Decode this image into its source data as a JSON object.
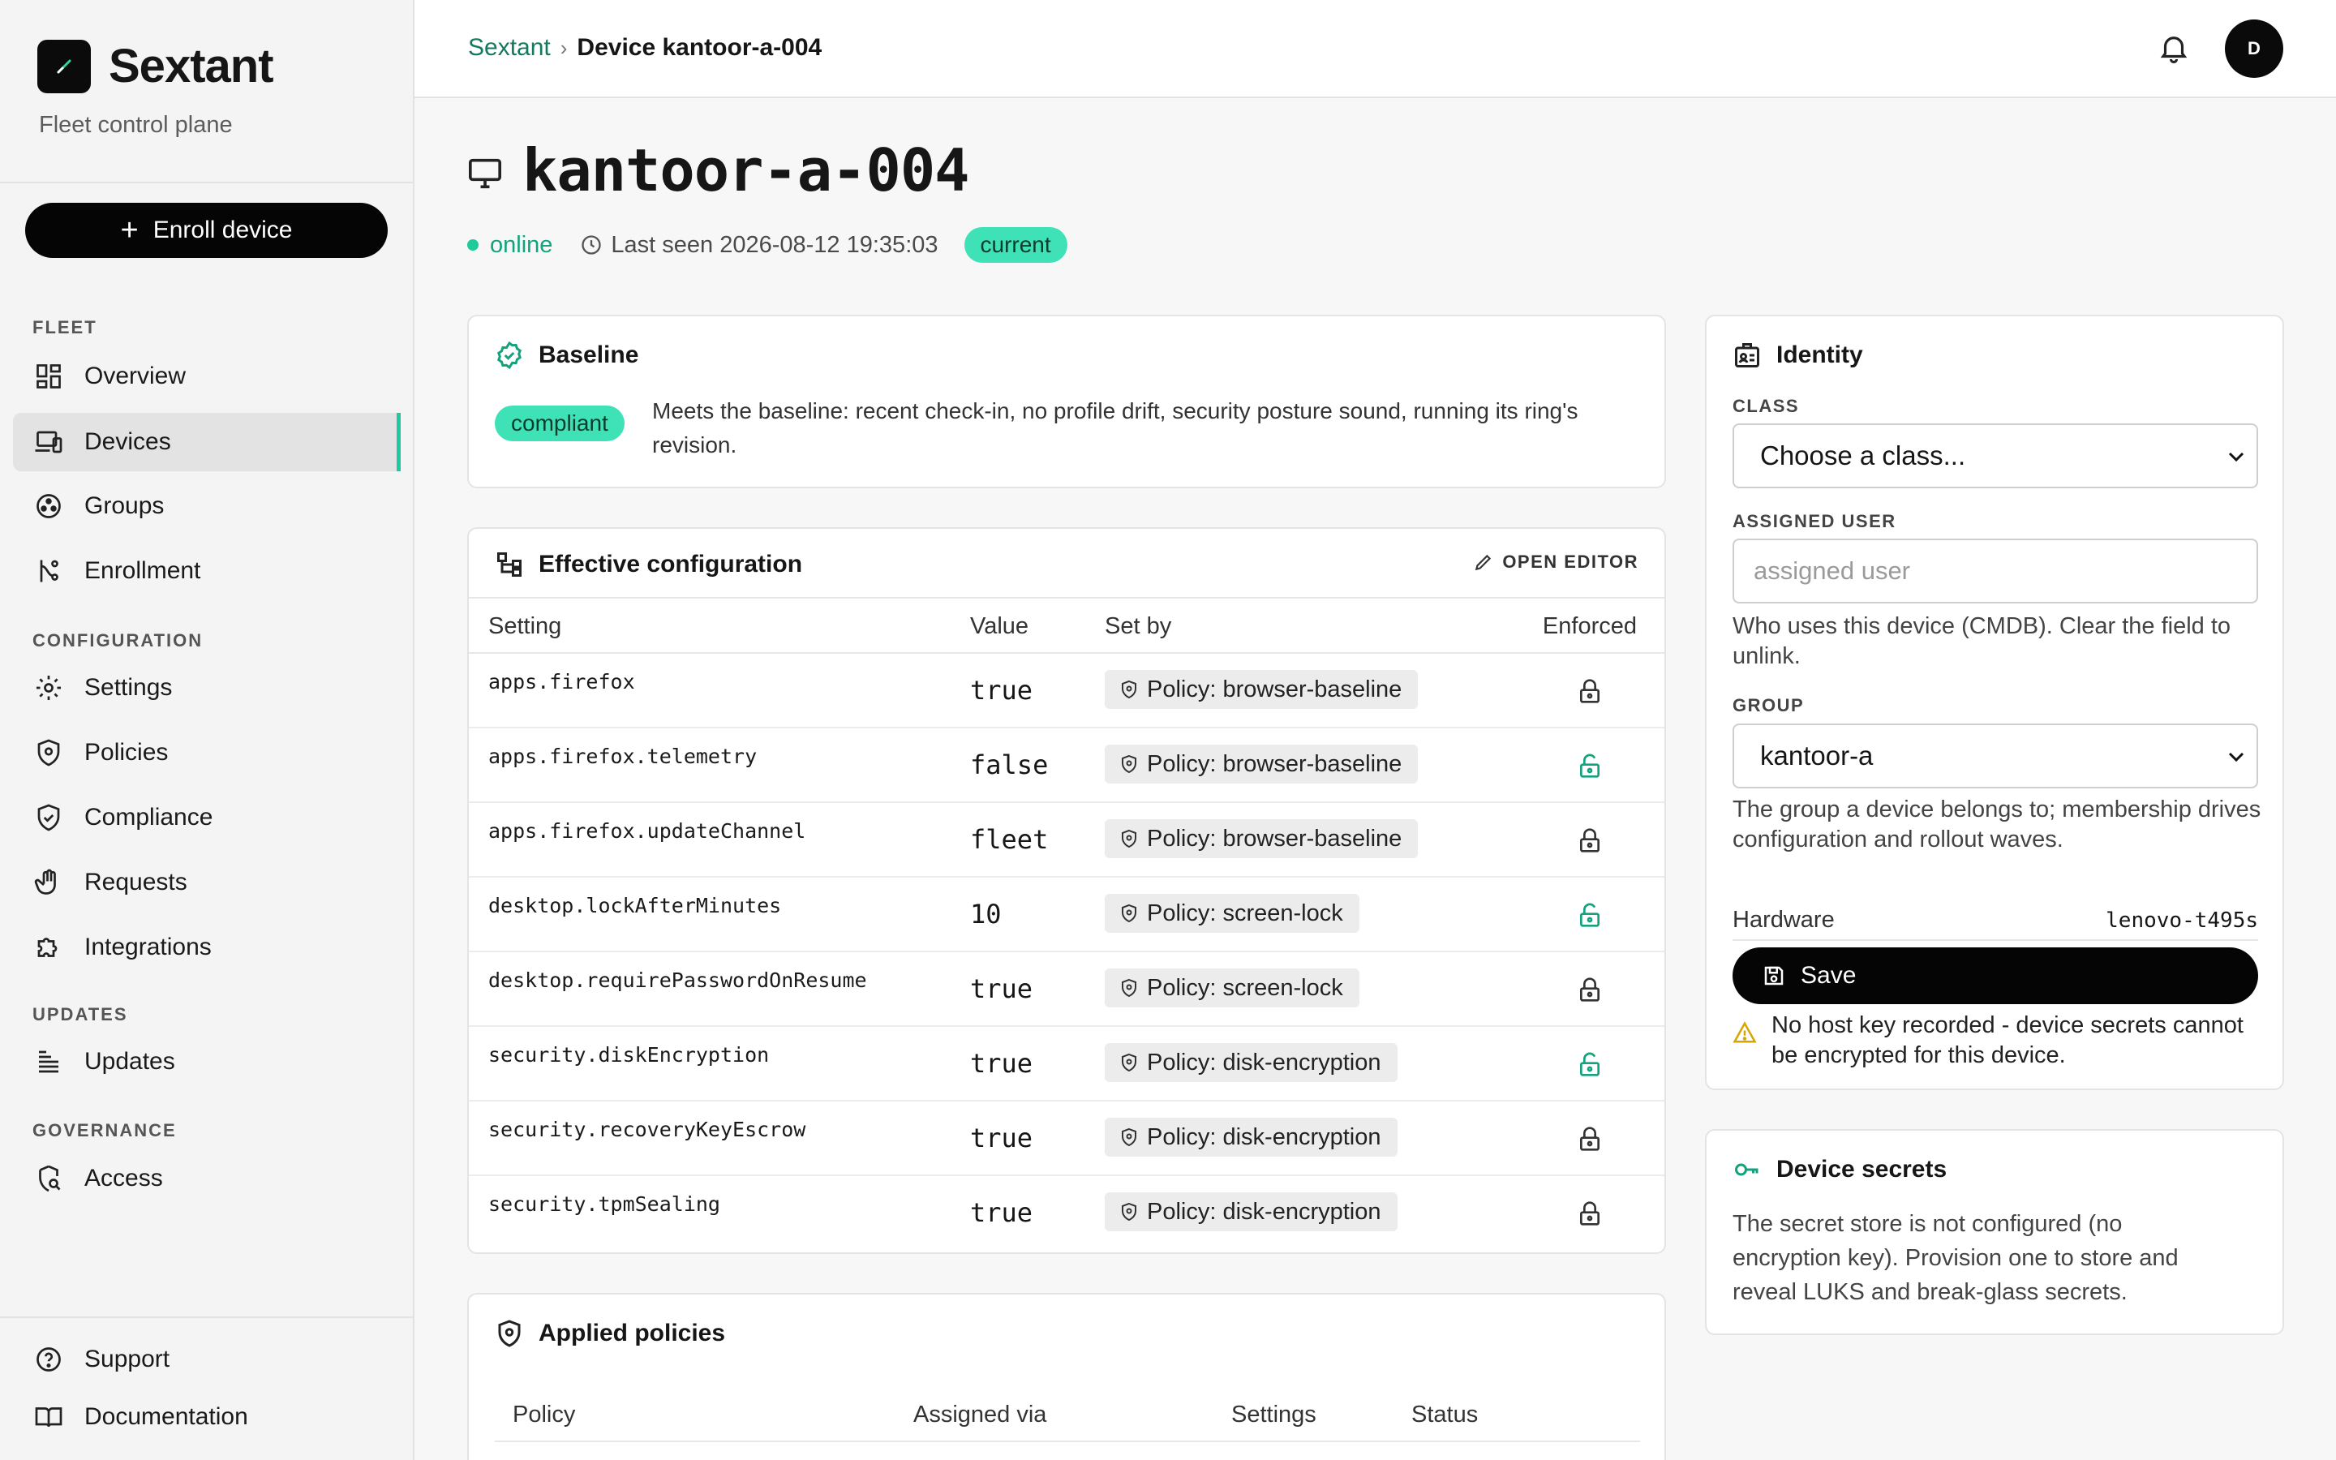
{
  "sidebar": {
    "brand_name": "Sextant",
    "brand_subtitle": "Fleet control plane",
    "enroll_label": "Enroll device",
    "sections": {
      "fleet": "FLEET",
      "configuration": "CONFIGURATION",
      "updates": "UPDATES",
      "governance": "GOVERNANCE"
    },
    "items": {
      "overview": "Overview",
      "devices": "Devices",
      "groups": "Groups",
      "enrollment": "Enrollment",
      "settings": "Settings",
      "policies": "Policies",
      "compliance": "Compliance",
      "requests": "Requests",
      "integrations": "Integrations",
      "updates": "Updates",
      "access": "Access"
    },
    "footer": {
      "support": "Support",
      "documentation": "Documentation"
    },
    "active_item": "devices"
  },
  "topbar": {
    "breadcrumb_root": "Sextant",
    "breadcrumb_current": "Device kantoor-a-004",
    "avatar_initial": "D"
  },
  "device": {
    "name": "kantoor-a-004",
    "status": "online",
    "last_seen": "Last seen 2026-08-12 19:35:03",
    "version_badge": "current"
  },
  "baseline": {
    "title": "Baseline",
    "badge": "compliant",
    "description": "Meets the baseline: recent check-in, no profile drift, security posture sound, running its ring's revision."
  },
  "effective_config": {
    "title": "Effective configuration",
    "open_editor": "OPEN EDITOR",
    "columns": {
      "setting": "Setting",
      "value": "Value",
      "set_by": "Set by",
      "enforced": "Enforced"
    },
    "rows": [
      {
        "setting": "apps.firefox",
        "value": "true",
        "set_by": "Policy: browser-baseline",
        "enforced": false
      },
      {
        "setting": "apps.firefox.telemetry",
        "value": "false",
        "set_by": "Policy: browser-baseline",
        "enforced": true
      },
      {
        "setting": "apps.firefox.updateChannel",
        "value": "fleet",
        "set_by": "Policy: browser-baseline",
        "enforced": false
      },
      {
        "setting": "desktop.lockAfterMinutes",
        "value": "10",
        "set_by": "Policy: screen-lock",
        "enforced": true
      },
      {
        "setting": "desktop.requirePasswordOnResume",
        "value": "true",
        "set_by": "Policy: screen-lock",
        "enforced": false
      },
      {
        "setting": "security.diskEncryption",
        "value": "true",
        "set_by": "Policy: disk-encryption",
        "enforced": true
      },
      {
        "setting": "security.recoveryKeyEscrow",
        "value": "true",
        "set_by": "Policy: disk-encryption",
        "enforced": false
      },
      {
        "setting": "security.tpmSealing",
        "value": "true",
        "set_by": "Policy: disk-encryption",
        "enforced": false
      }
    ]
  },
  "applied_policies": {
    "title": "Applied policies",
    "columns": {
      "policy": "Policy",
      "assigned_via": "Assigned via",
      "settings": "Settings",
      "status": "Status"
    }
  },
  "identity": {
    "title": "Identity",
    "class_label": "CLASS",
    "class_value": "Choose a class...",
    "user_label": "ASSIGNED USER",
    "user_placeholder": "assigned user",
    "user_help": "Who uses this device (CMDB). Clear the field to unlink.",
    "group_label": "GROUP",
    "group_value": "kantoor-a",
    "group_help": "The group a device belongs to; membership drives configuration and rollout waves.",
    "hardware_label": "Hardware",
    "hardware_value": "lenovo-t495s",
    "save_label": "Save",
    "warning": "No host key recorded - device secrets cannot be encrypted for this device."
  },
  "secrets": {
    "title": "Device secrets",
    "text": "The secret store is not configured (no encryption key). Provision one to store and reveal LUKS and break-glass secrets."
  },
  "colors": {
    "accent": "#22c8a3",
    "badge_bg": "#3fe2b6",
    "link": "#13795f",
    "enforced_lock": "#13a37c",
    "warning": "#d9a400"
  }
}
